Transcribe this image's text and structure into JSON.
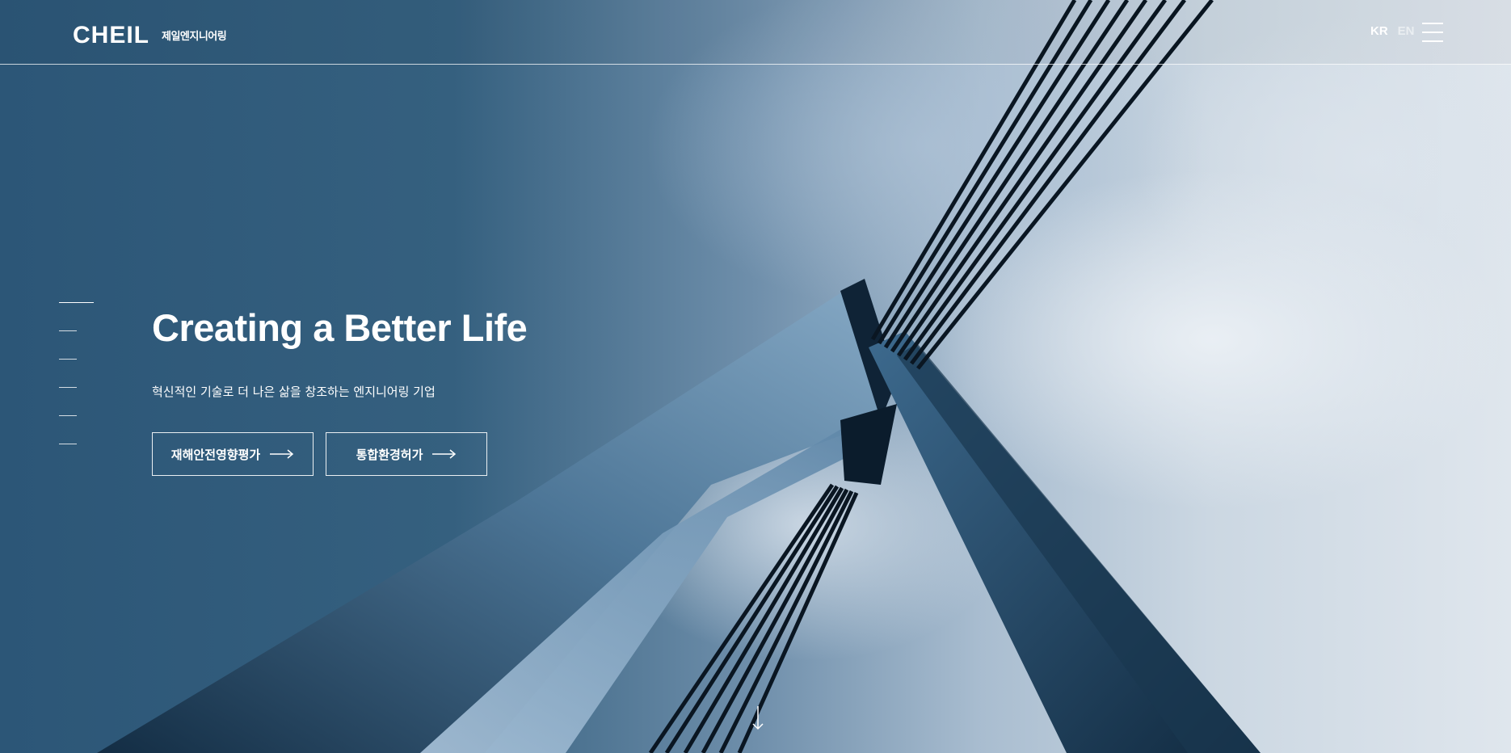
{
  "header": {
    "logo_text": "CHEIL",
    "logo_subtitle": "제일엔지니어링",
    "lang_kr": "KR",
    "lang_en": "EN",
    "menu_icon": "hamburger-menu-icon"
  },
  "hero": {
    "title": "Creating a Better Life",
    "subtitle": "혁신적인 기술로 더 나은 삶을 창조하는 엔지니어링 기업",
    "buttons": [
      {
        "label": "재해안전영향평가",
        "icon": "arrow-right-icon"
      },
      {
        "label": "통합환경허가",
        "icon": "arrow-right-icon"
      }
    ],
    "slide_count": 6,
    "active_slide": 1,
    "scroll_icon": "arrow-down-icon"
  },
  "colors": {
    "sky_dark": "#2c5677",
    "sky_light": "#dfe6ed",
    "text": "#ffffff"
  }
}
